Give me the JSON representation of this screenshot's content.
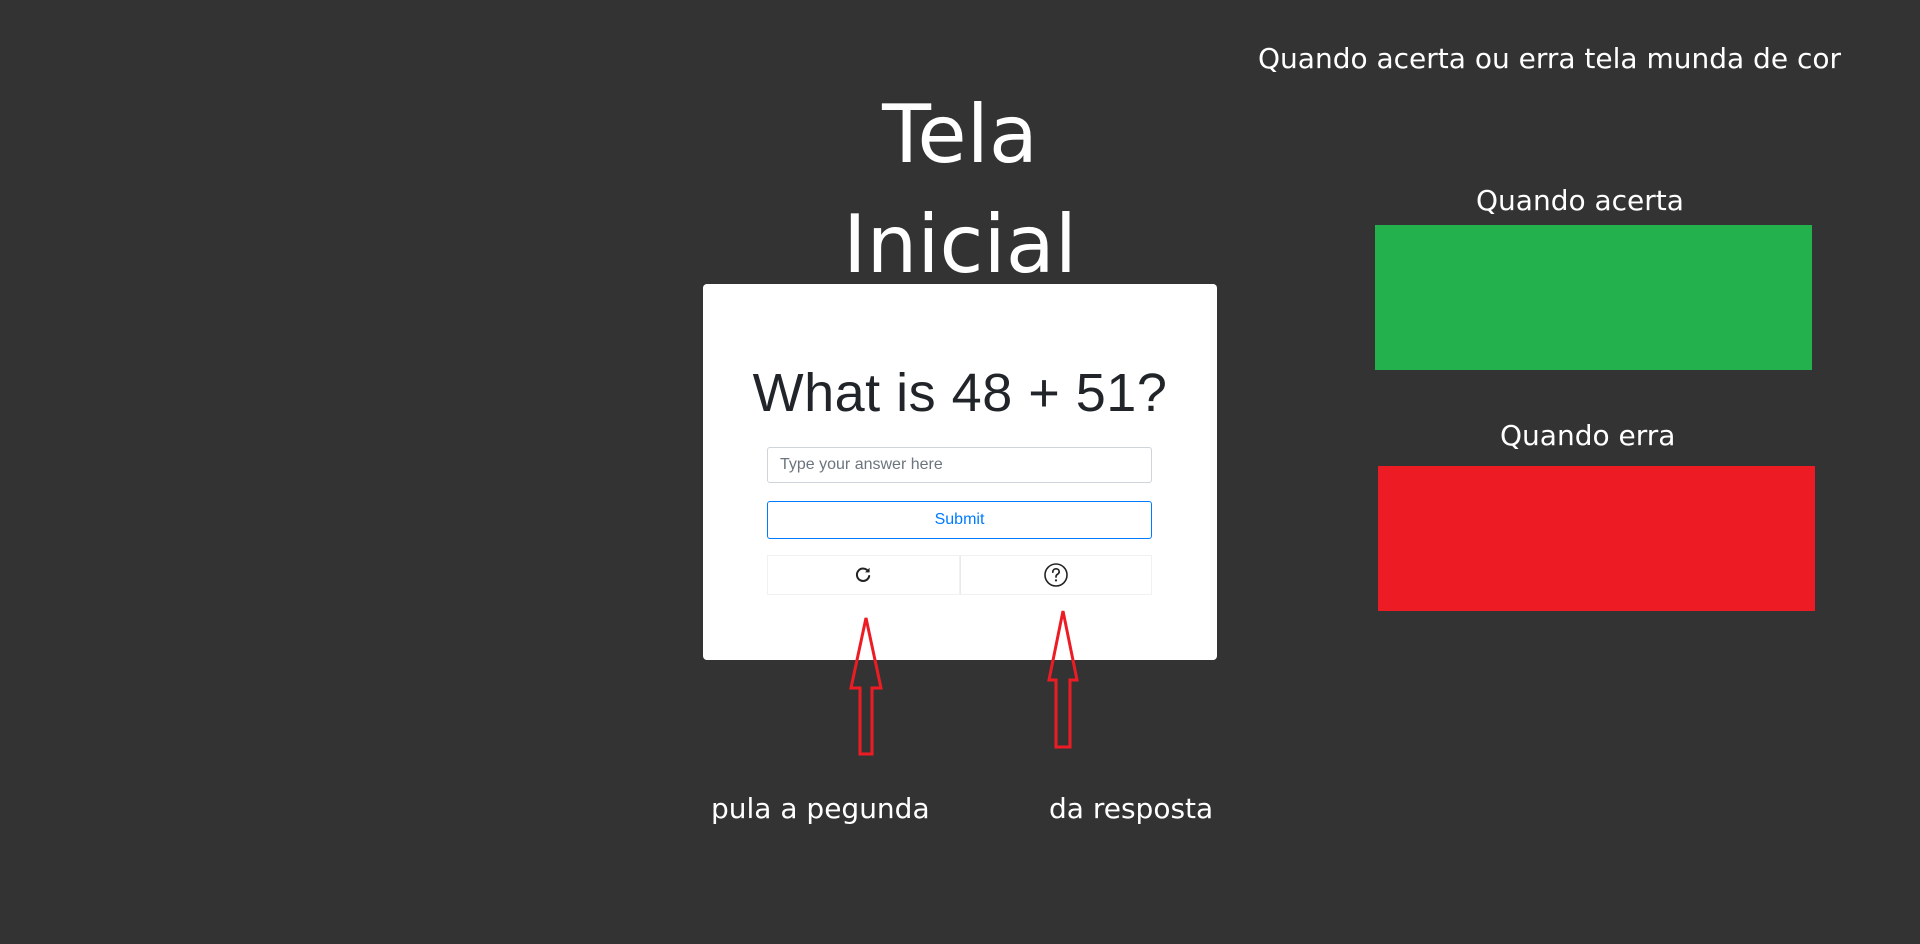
{
  "header": {
    "title": "Tela Inicial"
  },
  "annotations": {
    "top_note": "Quando acerta ou erra tela munda de cor",
    "correct_label": "Quando acerta",
    "wrong_label": "Quando erra",
    "skip_label": "pula a pegunda",
    "answer_label": "da resposta"
  },
  "swatches": {
    "correct_color": "#22b14c",
    "wrong_color": "#ed1c24"
  },
  "quiz": {
    "question": "What is 48 + 51?",
    "input_placeholder": "Type your answer here",
    "input_value": "",
    "submit_label": "Submit",
    "skip_icon": "refresh-icon",
    "hint_icon": "question-circle-icon"
  },
  "colors": {
    "background": "#333333",
    "card": "#ffffff",
    "accent": "#007bff",
    "arrow": "#ed1c24"
  }
}
